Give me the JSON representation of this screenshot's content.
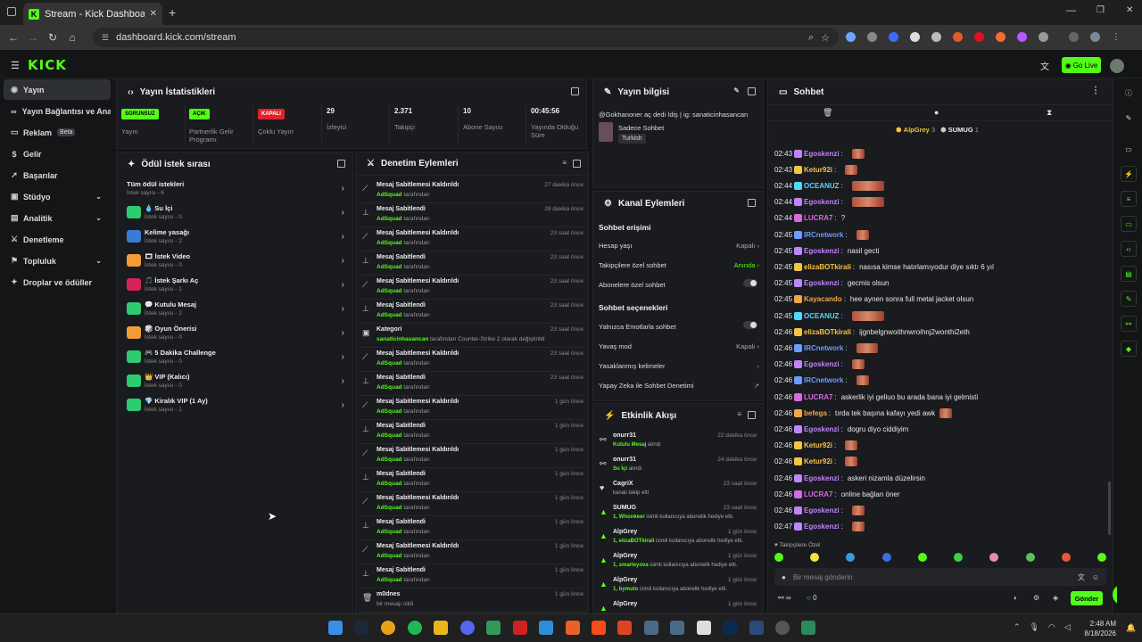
{
  "browser": {
    "tab_title": "Stream - Kick Dashboard",
    "url": "dashboard.kick.com/stream"
  },
  "header": {
    "logo": "KICK",
    "go_live": "Go Live"
  },
  "sidebar": {
    "items": [
      {
        "label": "Yayın"
      },
      {
        "label": "Yayın Bağlantısı ve Anahtarı"
      },
      {
        "label": "Reklam",
        "badge": "Beta"
      },
      {
        "label": "Gelir"
      },
      {
        "label": "Başarılar"
      },
      {
        "label": "Stüdyo"
      },
      {
        "label": "Analitik"
      },
      {
        "label": "Denetleme"
      },
      {
        "label": "Topluluk"
      },
      {
        "label": "Droplar ve ödüller"
      }
    ]
  },
  "stats": {
    "title": "Yayın İstatistikleri",
    "items": [
      {
        "value": "SORUNSUZ",
        "label": "Yayın"
      },
      {
        "value": "AÇIK",
        "label": "Partnerlik Gelir Programı"
      },
      {
        "value": "KAPALI",
        "label": "Çoklu Yayın"
      },
      {
        "value": "29",
        "label": "İzleyici"
      },
      {
        "value": "2.371",
        "label": "Takipçi"
      },
      {
        "value": "10",
        "label": "Abone Sayısı"
      },
      {
        "value": "00:45:56",
        "label": "Yayında Olduğu Süre"
      }
    ],
    "colors": {
      "ok": "#53fc18",
      "off": "#e5202a"
    }
  },
  "stream_info": {
    "title": "Yayın bilgisi",
    "stream_title": "@Gokhanoner aç dedi İdiş | ig: sanaticinhasancan",
    "category": "Sadece Sohbet",
    "language": "Turkish"
  },
  "reward_queue": {
    "title": "Ödül istek sırası",
    "items": [
      {
        "name": "Tüm ödül istekleri",
        "count": "İstek sayısı - 6"
      },
      {
        "name": "💧 Su İçi",
        "count": "İstek sayısı - 0",
        "color": "#2ecc71"
      },
      {
        "name": "Kelime yasağı",
        "count": "İstek sayısı - 2",
        "color": "#3a7bd5"
      },
      {
        "name": "🎞 İstek Video",
        "count": "İstek sayısı - 0",
        "color": "#f39c35"
      },
      {
        "name": "🎵 İstek Şarkı Aç",
        "count": "İstek sayısı - 1",
        "color": "#d6245b"
      },
      {
        "name": "💬 Kutulu Mesaj",
        "count": "İstek sayısı - 2",
        "color": "#2ecc71"
      },
      {
        "name": "🎲 Oyun Önerisi",
        "count": "İstek sayısı - 0",
        "color": "#f39c35"
      },
      {
        "name": "🎮 5 Dakika Challenge",
        "count": "İstek sayısı - 0",
        "color": "#2ecc71"
      },
      {
        "name": "👑 VIP (Kalıcı)",
        "count": "İstek sayısı - 0",
        "color": "#2ecc71"
      },
      {
        "name": "💎 Kiralık VIP (1 Ay)",
        "count": "İstek sayısı - 1",
        "color": "#2ecc71"
      }
    ]
  },
  "moderation": {
    "title": "Denetim Eylemleri",
    "items": [
      {
        "action": "Mesaj Sabitlemesi Kaldırıldı",
        "by": "AdSquad",
        "suffix": "tarafından",
        "time": "27 dakika önce",
        "icon": "unpin"
      },
      {
        "action": "Mesaj Sabitlendi",
        "by": "AdSquad",
        "suffix": "tarafından",
        "time": "28 dakika önce",
        "icon": "pin"
      },
      {
        "action": "Mesaj Sabitlemesi Kaldırıldı",
        "by": "AdSquad",
        "suffix": "tarafından",
        "time": "23 saat önce",
        "icon": "unpin"
      },
      {
        "action": "Mesaj Sabitlendi",
        "by": "AdSquad",
        "suffix": "tarafından",
        "time": "23 saat önce",
        "icon": "pin"
      },
      {
        "action": "Mesaj Sabitlemesi Kaldırıldı",
        "by": "AdSquad",
        "suffix": "tarafından",
        "time": "23 saat önce",
        "icon": "unpin"
      },
      {
        "action": "Mesaj Sabitlendi",
        "by": "AdSquad",
        "suffix": "tarafından",
        "time": "23 saat önce",
        "icon": "pin"
      },
      {
        "action": "Kategori",
        "by": "sanaticinhasancan",
        "suffix": "tarafından Counter-Strike 2 olarak değiştirildi",
        "time": "23 saat önce",
        "icon": "category"
      },
      {
        "action": "Mesaj Sabitlemesi Kaldırıldı",
        "by": "AdSquad",
        "suffix": "tarafından",
        "time": "23 saat önce",
        "icon": "unpin"
      },
      {
        "action": "Mesaj Sabitlendi",
        "by": "AdSquad",
        "suffix": "tarafından",
        "time": "23 saat önce",
        "icon": "pin"
      },
      {
        "action": "Mesaj Sabitlemesi Kaldırıldı",
        "by": "AdSquad",
        "suffix": "tarafından",
        "time": "1 gün önce",
        "icon": "unpin"
      },
      {
        "action": "Mesaj Sabitlendi",
        "by": "AdSquad",
        "suffix": "tarafından",
        "time": "1 gün önce",
        "icon": "pin"
      },
      {
        "action": "Mesaj Sabitlemesi Kaldırıldı",
        "by": "AdSquad",
        "suffix": "tarafından",
        "time": "1 gün önce",
        "icon": "unpin"
      },
      {
        "action": "Mesaj Sabitlendi",
        "by": "AdSquad",
        "suffix": "tarafından",
        "time": "1 gün önce",
        "icon": "pin"
      },
      {
        "action": "Mesaj Sabitlemesi Kaldırıldı",
        "by": "AdSquad",
        "suffix": "tarafından",
        "time": "1 gün önce",
        "icon": "unpin"
      },
      {
        "action": "Mesaj Sabitlendi",
        "by": "AdSquad",
        "suffix": "tarafından",
        "time": "1 gün önce",
        "icon": "pin"
      },
      {
        "action": "Mesaj Sabitlemesi Kaldırıldı",
        "by": "AdSquad",
        "suffix": "tarafından",
        "time": "1 gün önce",
        "icon": "unpin"
      },
      {
        "action": "Mesaj Sabitlendi",
        "by": "AdSquad",
        "suffix": "tarafından",
        "time": "1 gün önce",
        "icon": "pin"
      },
      {
        "action": "m0dnes",
        "by": "",
        "suffix": "bir mesajı sildi",
        "time": "1 gün önce",
        "icon": "trash"
      }
    ]
  },
  "channel_actions": {
    "title": "Kanal Eylemleri",
    "chat_access": "Sohbet erişimi",
    "account_age": "Hesap yaşı",
    "account_age_value": "Kapalı",
    "followers_only": "Takipçilere özel sohbet",
    "followers_only_value": "Anında",
    "subs_only": "Abonelere özel sohbet",
    "chat_options": "Sohbet seçenekleri",
    "emotes_only": "Yalnızca Emotlarla sohbet",
    "slow_mode": "Yavaş mod",
    "slow_mode_value": "Kapalı",
    "banned_words": "Yasaklanmış kelimeler",
    "ai_moderation": "Yapay Zeka ile Sohbet Denetimi"
  },
  "activity": {
    "title": "Etkinlik Akışı",
    "items": [
      {
        "user": "onurr31",
        "detail_bold": "Kutulu Mesaj",
        "detail": "alındı",
        "time": "22 dakika önce"
      },
      {
        "user": "onurr31",
        "detail_bold": "Su İçi",
        "detail": "alındı",
        "time": "24 dakika önce"
      },
      {
        "user": "CagriX",
        "detail_bold": "",
        "detail": "kanalı takip etti",
        "time": "23 saat önce"
      },
      {
        "user": "SUMUG",
        "detail_bold": "1, Whonkeer",
        "detail": "isimli kullanıcıya abonelik hediye etti.",
        "time": "23 saat önce"
      },
      {
        "user": "AlpGrey",
        "detail_bold": "1, elizaBOTkirali",
        "detail": "isimli kullanıcıya abonelik hediye etti.",
        "time": "1 gün önce"
      },
      {
        "user": "AlpGrey",
        "detail_bold": "1, smarleyova",
        "detail": "isimli kullanıcıya abonelik hediye etti.",
        "time": "1 gün önce"
      },
      {
        "user": "AlpGrey",
        "detail_bold": "1, bymuto",
        "detail": "isimli kullanıcıya abonelik hediye etti.",
        "time": "1 gün önce"
      },
      {
        "user": "AlpGrey",
        "detail_bold": "",
        "detail": "",
        "time": "1 gün önce"
      }
    ]
  },
  "chat": {
    "title": "Sohbet",
    "leaders": [
      {
        "name": "AlpGrey",
        "count": "3"
      },
      {
        "name": "SUMUG",
        "count": "1"
      }
    ],
    "messages": [
      {
        "time": "02:43",
        "user": "Egoskenzi",
        "color": "#c084fc",
        "text": "",
        "emote": 14
      },
      {
        "time": "02:43",
        "user": "Ketur92i",
        "color": "#f6c343",
        "text": "",
        "emote": 14
      },
      {
        "time": "02:44",
        "user": "OCEANUZ",
        "color": "#53d6fc",
        "text": "",
        "emote": 36
      },
      {
        "time": "02:44",
        "user": "Egoskenzi",
        "color": "#c084fc",
        "text": "",
        "emote": 36
      },
      {
        "time": "02:44",
        "user": "LUCRA7",
        "color": "#d46be0",
        "text": "?",
        "emote": 0
      },
      {
        "time": "02:45",
        "user": "IRCnetwork",
        "color": "#6b9cff",
        "text": "",
        "emote": 14
      },
      {
        "time": "02:45",
        "user": "Egoskenzi",
        "color": "#c084fc",
        "text": "nasil gecti",
        "emote": 0
      },
      {
        "time": "02:45",
        "user": "elizaBOTkirali",
        "color": "#f6c343",
        "text": "nasısa kimse hatırlamıyodur diye sıktı 6 yıl",
        "emote": 0
      },
      {
        "time": "02:45",
        "user": "Egoskenzi",
        "color": "#c084fc",
        "text": "gecmis olsun",
        "emote": 0
      },
      {
        "time": "02:45",
        "user": "Kayacando",
        "color": "#f6a443",
        "text": "hee aynen sonra full metal jacket olsun",
        "emote": 0
      },
      {
        "time": "02:45",
        "user": "OCEANUZ",
        "color": "#53d6fc",
        "text": "",
        "emote": 36
      },
      {
        "time": "02:46",
        "user": "elizaBOTkirali",
        "color": "#f6c343",
        "text": "ijgnbelgnwoithnwroihnj2wonthi2eth",
        "emote": 0
      },
      {
        "time": "02:46",
        "user": "IRCnetwork",
        "color": "#6b9cff",
        "text": "",
        "emote": 24
      },
      {
        "time": "02:46",
        "user": "Egoskenzi",
        "color": "#c084fc",
        "text": "",
        "emote": 14
      },
      {
        "time": "02:46",
        "user": "IRCnetwork",
        "color": "#6b9cff",
        "text": "",
        "emote": 14
      },
      {
        "time": "02:46",
        "user": "LUCRA7",
        "color": "#d46be0",
        "text": "askerlik iyi geliuo bu arada bana iyi gelmisti",
        "emote": 0
      },
      {
        "time": "02:46",
        "user": "befega",
        "color": "#f6a443",
        "text": "tırda tek başına kafayı yedi awk",
        "emote": 14
      },
      {
        "time": "02:46",
        "user": "Egoskenzi",
        "color": "#c084fc",
        "text": "dogru diyo ciddiyim",
        "emote": 0
      },
      {
        "time": "02:46",
        "user": "Ketur92i",
        "color": "#f6c343",
        "text": "",
        "emote": 14
      },
      {
        "time": "02:46",
        "user": "Ketur92i",
        "color": "#f6c343",
        "text": "",
        "emote": 14
      },
      {
        "time": "02:46",
        "user": "Egoskenzi",
        "color": "#c084fc",
        "text": "askeri nizamla düzelirsin",
        "emote": 0
      },
      {
        "time": "02:46",
        "user": "LUCRA7",
        "color": "#d46be0",
        "text": "online bağlan öner",
        "emote": 0
      },
      {
        "time": "02:46",
        "user": "Egoskenzi",
        "color": "#c084fc",
        "text": "",
        "emote": 14
      },
      {
        "time": "02:47",
        "user": "Egoskenzi",
        "color": "#c084fc",
        "text": "",
        "emote": 14
      }
    ],
    "followers_only_note": "Takipçilere Özel",
    "input_placeholder": "Bir mesaj gönderin",
    "send_label": "Gönder",
    "viewer_count": "0"
  },
  "taskbar": {
    "time": "2:48 AM",
    "date": "8/18/2026"
  }
}
